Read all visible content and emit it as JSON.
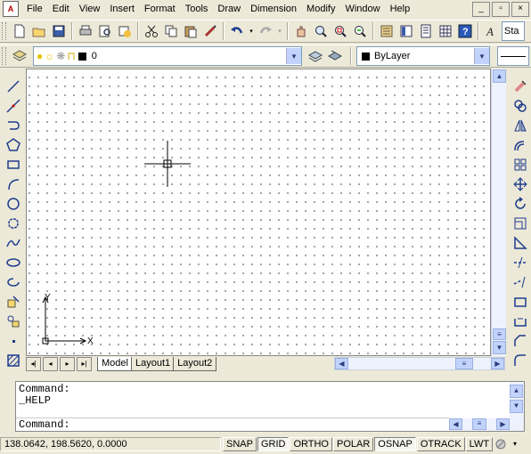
{
  "menu": [
    "File",
    "Edit",
    "View",
    "Insert",
    "Format",
    "Tools",
    "Draw",
    "Dimension",
    "Modify",
    "Window",
    "Help"
  ],
  "window_buttons": [
    "_",
    "▫",
    "×"
  ],
  "style_combo": "Sta",
  "layer_combo": {
    "value": "0"
  },
  "color_combo": {
    "value": "ByLayer"
  },
  "ucs": {
    "x_label": "X",
    "y_label": "Y"
  },
  "tabs": {
    "nav": [
      "◂|",
      "◂",
      "▸",
      "▸|"
    ],
    "items": [
      "Model",
      "Layout1",
      "Layout2"
    ],
    "active": "Model"
  },
  "command": {
    "lines": [
      "Command:",
      "_HELP"
    ],
    "prompt": "Command:"
  },
  "status": {
    "coordinates": "138.0642, 198.5620, 0.0000",
    "toggles": [
      {
        "label": "SNAP",
        "on": false
      },
      {
        "label": "GRID",
        "on": true
      },
      {
        "label": "ORTHO",
        "on": false
      },
      {
        "label": "POLAR",
        "on": false
      },
      {
        "label": "OSNAP",
        "on": true
      },
      {
        "label": "OTRACK",
        "on": false
      },
      {
        "label": "LWT",
        "on": false
      }
    ]
  }
}
